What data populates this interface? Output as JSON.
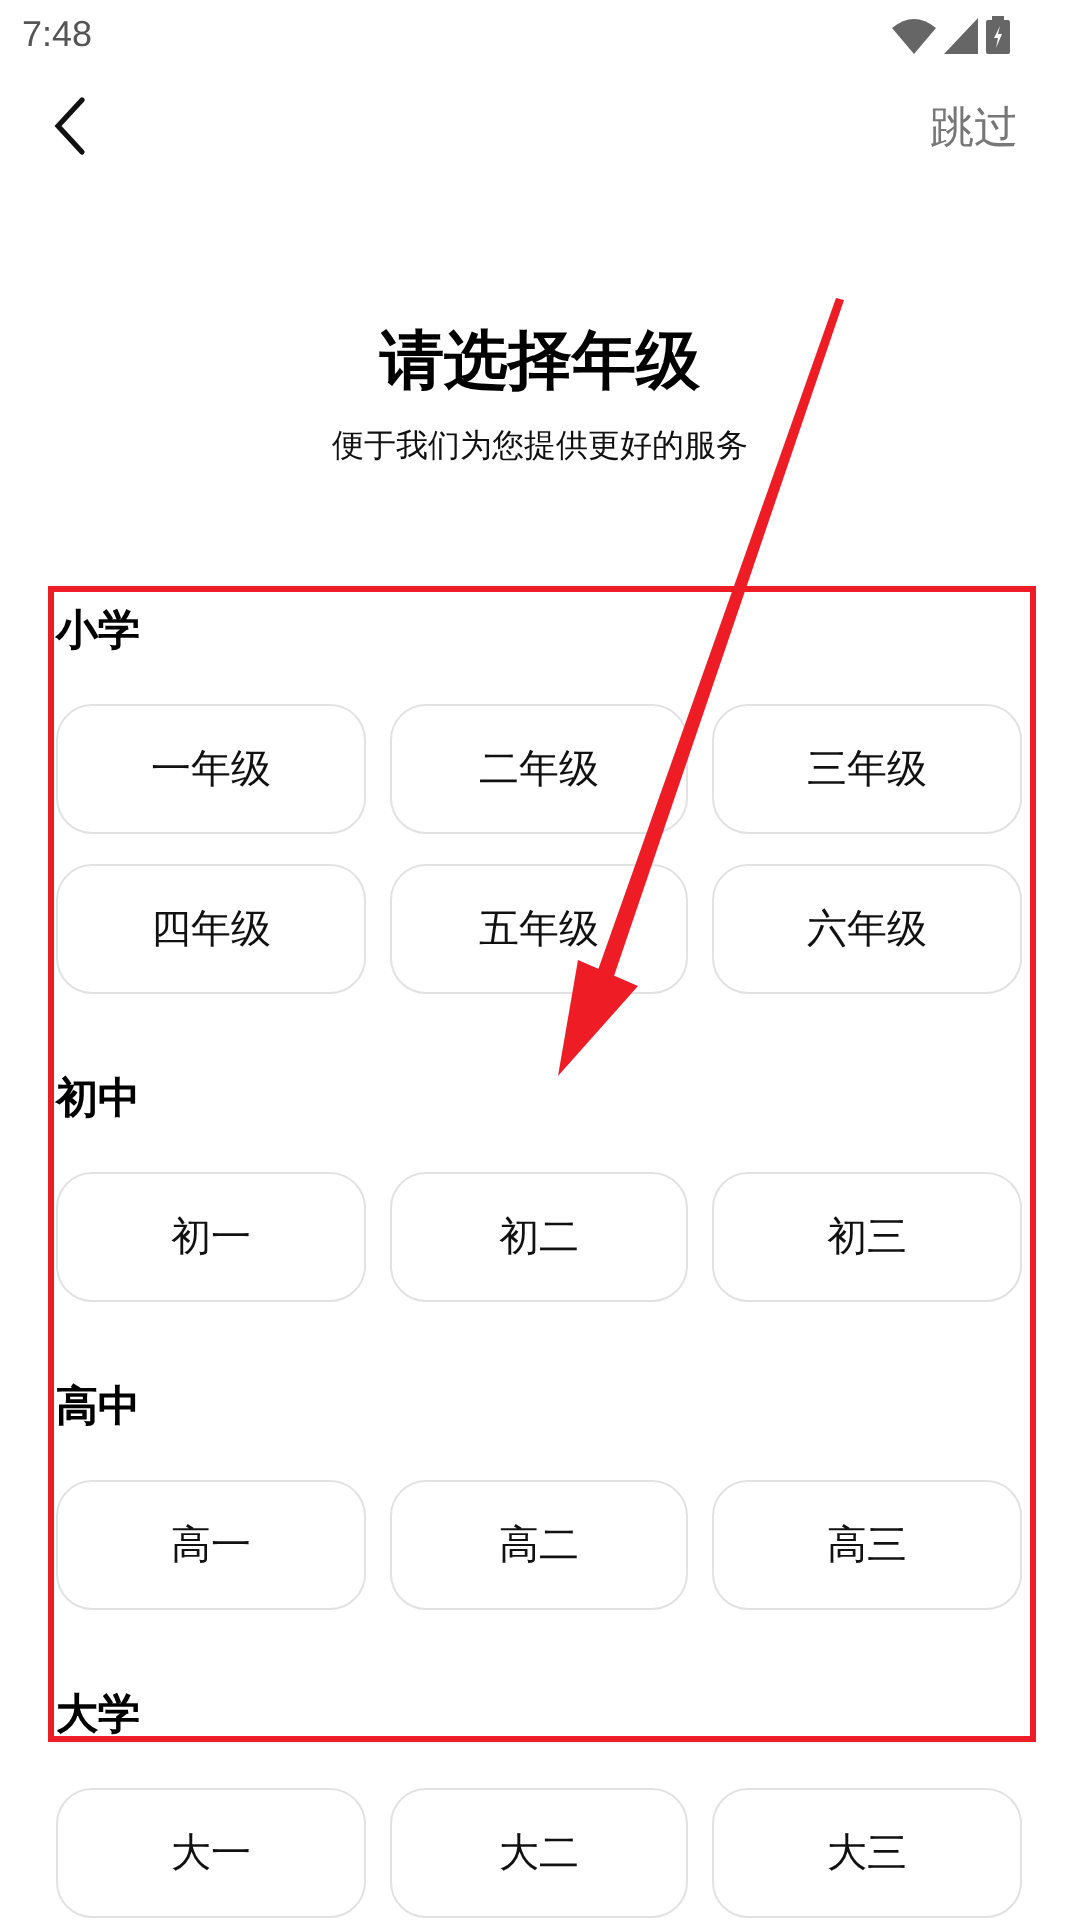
{
  "status_bar": {
    "time": "7:48"
  },
  "nav": {
    "skip": "跳过"
  },
  "title": "请选择年级",
  "subtitle": "便于我们为您提供更好的服务",
  "sections": [
    {
      "label": "小学",
      "options": [
        "一年级",
        "二年级",
        "三年级",
        "四年级",
        "五年级",
        "六年级"
      ]
    },
    {
      "label": "初中",
      "options": [
        "初一",
        "初二",
        "初三"
      ]
    },
    {
      "label": "高中",
      "options": [
        "高一",
        "高二",
        "高三"
      ]
    },
    {
      "label": "大学",
      "options": [
        "大一",
        "大二",
        "大三"
      ]
    }
  ]
}
